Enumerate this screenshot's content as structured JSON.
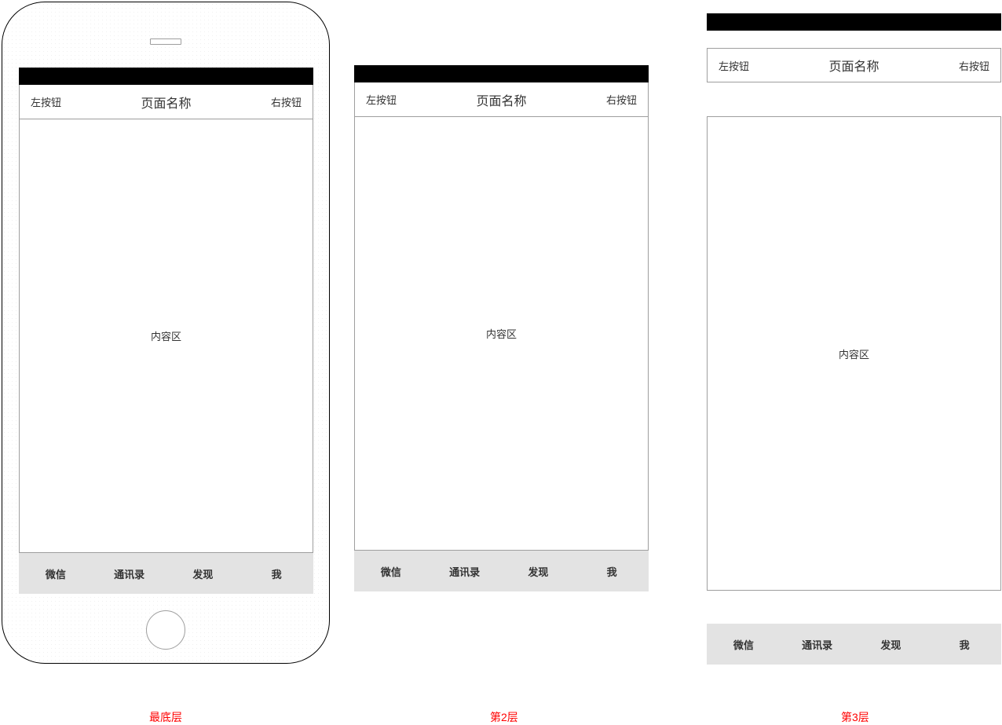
{
  "nav": {
    "left": "左按钮",
    "title": "页面名称",
    "right": "右按钮"
  },
  "content_label": "内容区",
  "tabs": [
    "微信",
    "通讯录",
    "发现",
    "我"
  ],
  "captions": {
    "layer1": "最底层",
    "layer2": "第2层",
    "layer3": "第3层"
  }
}
